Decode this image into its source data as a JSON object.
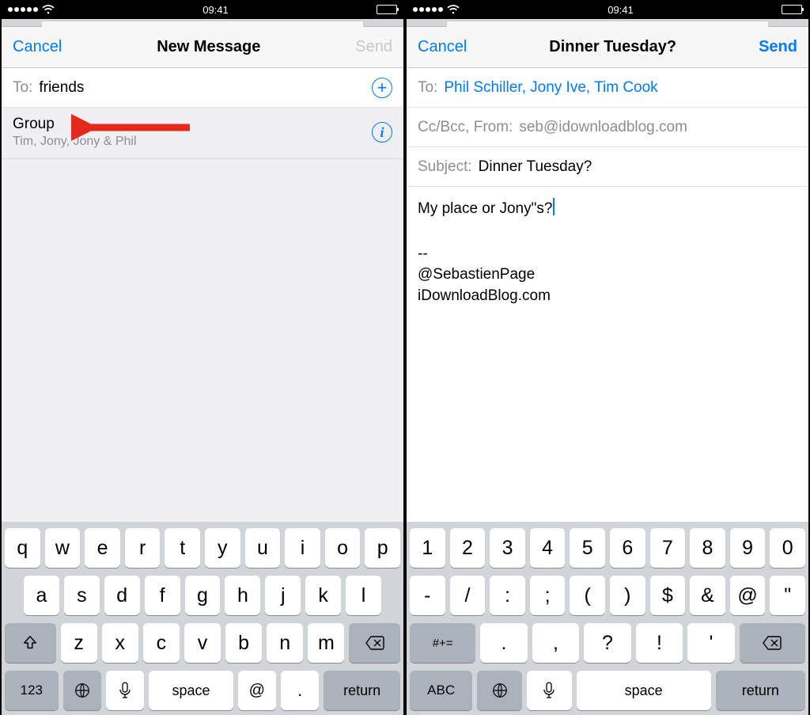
{
  "status": {
    "time": "09:41"
  },
  "left": {
    "nav": {
      "cancel": "Cancel",
      "title": "New Message",
      "send": "Send"
    },
    "to_label": "To:",
    "to_value": "friends",
    "suggestion": {
      "title": "Group",
      "sub": "Tim, Jony, Jony & Phil"
    }
  },
  "right": {
    "nav": {
      "cancel": "Cancel",
      "title": "Dinner Tuesday?",
      "send": "Send"
    },
    "to_label": "To:",
    "to_value": "Phil Schiller, Jony Ive, Tim Cook",
    "ccbcc_label": "Cc/Bcc, From:",
    "from_value": "seb@idownloadblog.com",
    "subject_label": "Subject:",
    "subject_value": "Dinner Tuesday?",
    "body_line1": "My place or Jony\"s?",
    "sig_dashes": "--",
    "sig_1": "@SebastienPage",
    "sig_2": "iDownloadBlog.com"
  },
  "keys": {
    "alpha_r1": [
      "q",
      "w",
      "e",
      "r",
      "t",
      "y",
      "u",
      "i",
      "o",
      "p"
    ],
    "alpha_r2": [
      "a",
      "s",
      "d",
      "f",
      "g",
      "h",
      "j",
      "k",
      "l"
    ],
    "alpha_r3": [
      "z",
      "x",
      "c",
      "v",
      "b",
      "n",
      "m"
    ],
    "num_r1": [
      "1",
      "2",
      "3",
      "4",
      "5",
      "6",
      "7",
      "8",
      "9",
      "0"
    ],
    "num_r2": [
      "-",
      "/",
      ":",
      ";",
      "(",
      ")",
      "$",
      "&",
      "@",
      "\""
    ],
    "num_r3": [
      ".",
      ",",
      "?",
      "!",
      "'"
    ],
    "labels": {
      "shift": "⇧",
      "del": "⌫",
      "n123": "123",
      "space": "space",
      "at": "@",
      "dot": ".",
      "return": "return",
      "abc": "ABC",
      "numalt": "#+="
    }
  }
}
